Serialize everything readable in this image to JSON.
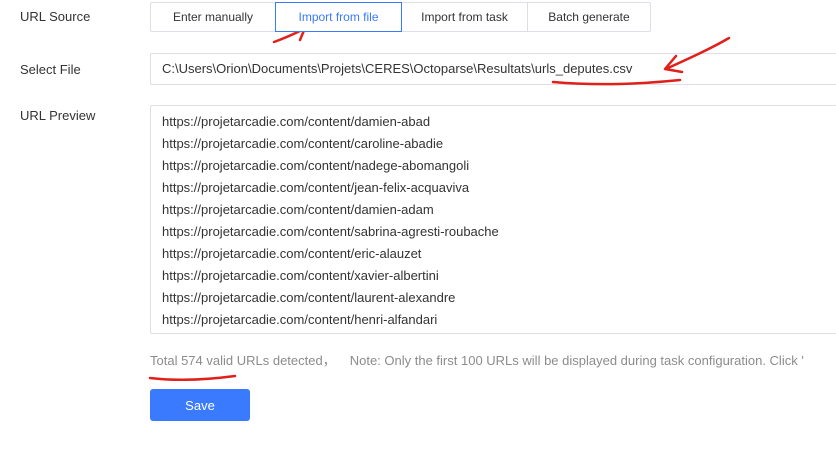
{
  "form": {
    "url_source_label": "URL Source",
    "select_file_label": "Select File",
    "url_preview_label": "URL Preview"
  },
  "source_tabs": [
    {
      "label": "Enter manually",
      "active": false
    },
    {
      "label": "Import from file",
      "active": true
    },
    {
      "label": "Import from task",
      "active": false
    },
    {
      "label": "Batch generate",
      "active": false
    }
  ],
  "file": {
    "path_prefix": "C:\\Users\\Orion\\Documents\\Projets\\CERES\\Octoparse\\Resultats\\",
    "file_name": "urls_deputes.csv"
  },
  "preview": {
    "urls": [
      "https://projetarcadie.com/content/damien-abad",
      "https://projetarcadie.com/content/caroline-abadie",
      "https://projetarcadie.com/content/nadege-abomangoli",
      "https://projetarcadie.com/content/jean-felix-acquaviva",
      "https://projetarcadie.com/content/damien-adam",
      "https://projetarcadie.com/content/sabrina-agresti-roubache",
      "https://projetarcadie.com/content/eric-alauzet",
      "https://projetarcadie.com/content/xavier-albertini",
      "https://projetarcadie.com/content/laurent-alexandre",
      "https://projetarcadie.com/content/henri-alfandari"
    ]
  },
  "summary": {
    "total_text": "Total 574 valid URLs detected，",
    "note_text": "Note: Only the first 100 URLs will be displayed during task configuration. Click '"
  },
  "actions": {
    "save_label": "Save"
  },
  "colors": {
    "accent": "#3a7afe",
    "annotation": "#e0201b"
  }
}
